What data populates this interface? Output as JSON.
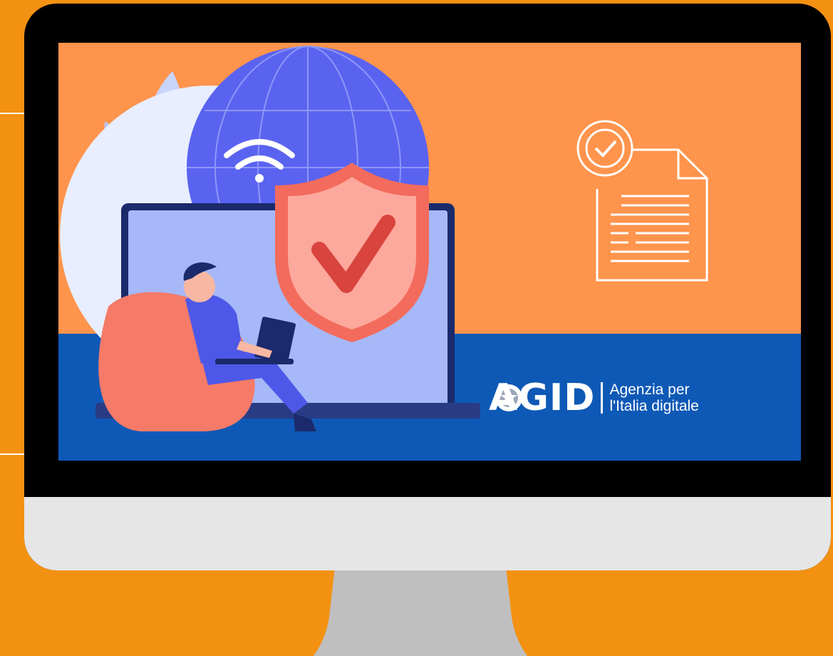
{
  "logo": {
    "wordmark": "AGID",
    "tagline_line1": "Agenzia per",
    "tagline_line2": "l'Italia digitale"
  },
  "colors": {
    "background": "#F39112",
    "screen_orange": "#FF944C",
    "screen_blue": "#0E59B6",
    "bezel": "#000000",
    "chin": "#E6E6E6",
    "stand": "#BFBFBF",
    "globe": "#5A63F0",
    "laptop_screen": "#A6B8F7",
    "shield": "#F36B5C",
    "checkmark": "#D9443E",
    "beanbag": "#F57A68"
  },
  "icons": [
    "globe-icon",
    "wifi-icon",
    "shield-check-icon",
    "certificate-document-icon",
    "person-with-laptop-illustration",
    "agid-emblem-icon"
  ]
}
